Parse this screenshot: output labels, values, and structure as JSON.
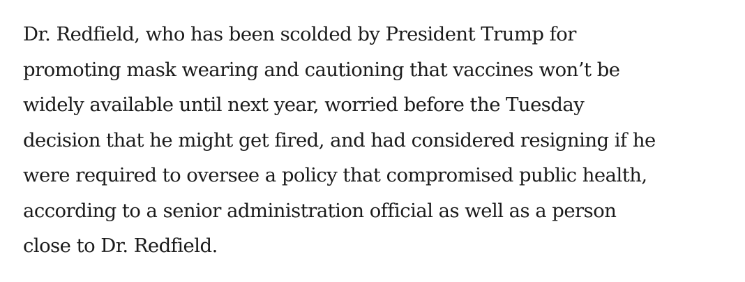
{
  "article": {
    "paragraph_lines": [
      "Dr. Redfield, who has been scolded by President Trump for",
      "promoting mask wearing and cautioning that vaccines won’t be",
      "widely available until next year, worried before the Tuesday",
      "decision that he might get fired, and had considered resigning if he",
      "were required to oversee a policy that compromised public health,",
      "according to a senior administration official as well as a person",
      "close to Dr. Redfield."
    ]
  }
}
